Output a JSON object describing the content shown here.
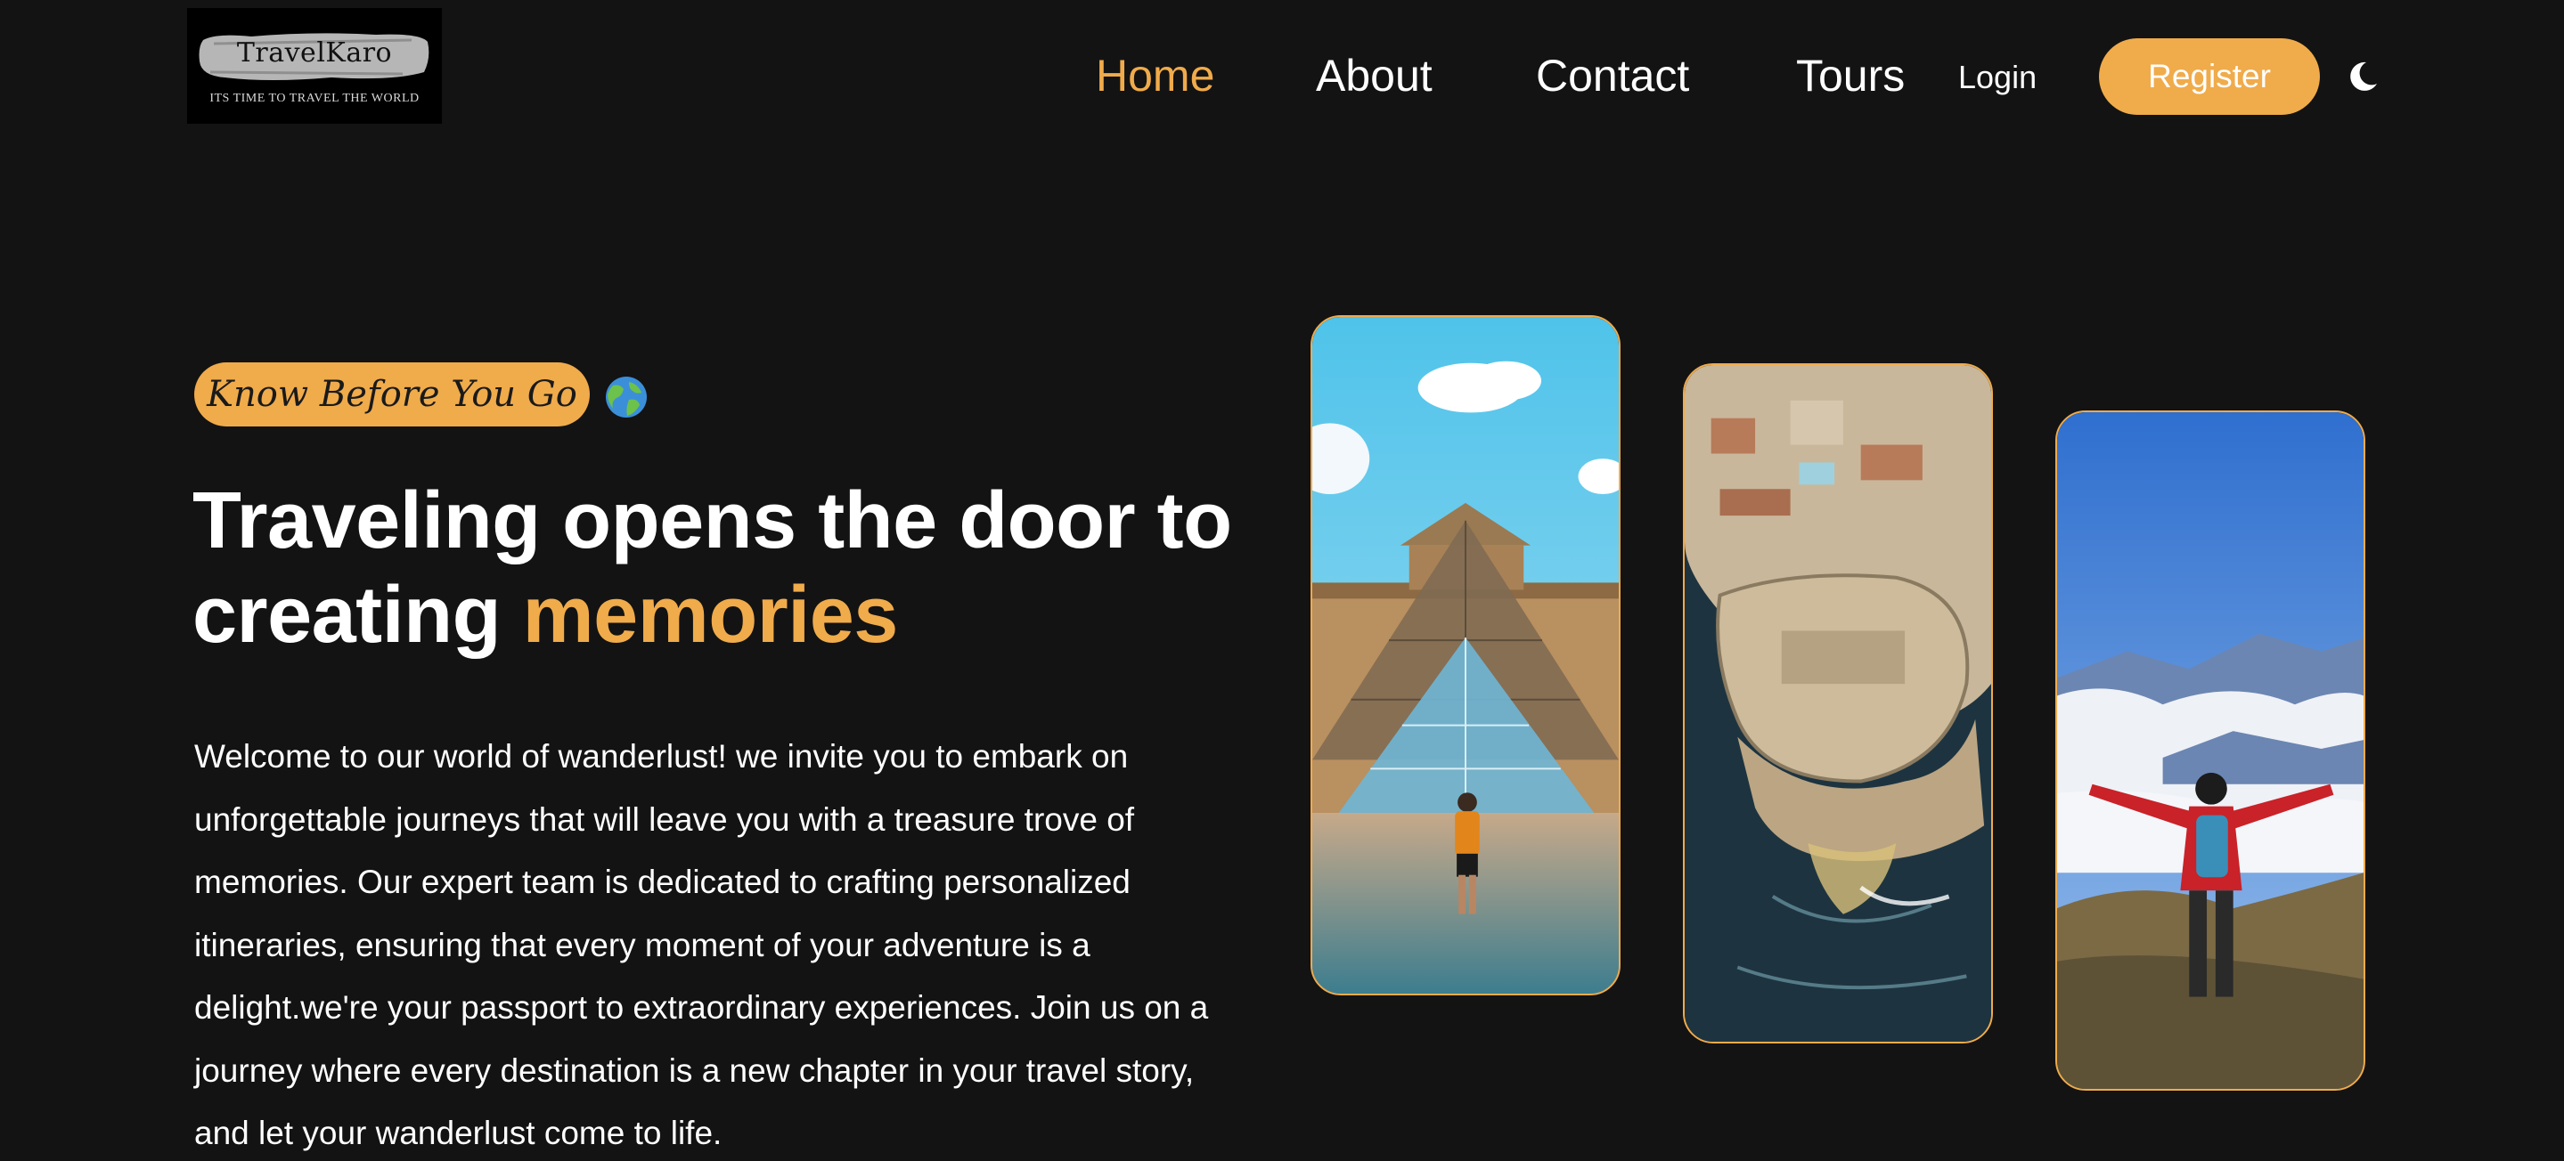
{
  "header": {
    "logo": {
      "name": "TravelKaro",
      "tagline": "Its time to travel the world"
    },
    "nav": [
      {
        "label": "Home",
        "active": true
      },
      {
        "label": "About",
        "active": false
      },
      {
        "label": "Contact",
        "active": false
      },
      {
        "label": "Tours",
        "active": false
      }
    ],
    "login_label": "Login",
    "register_label": "Register",
    "theme_icon": "moon-icon"
  },
  "hero": {
    "badge": "Know Before You Go",
    "badge_icon": "globe-icon",
    "headline_part1": "Traveling opens the door to creating ",
    "headline_accent": "memories",
    "description": "Welcome to our world of wanderlust! we invite you to embark on unforgettable journeys that will leave you with a treasure trove of memories. Our expert team is dedicated to crafting personalized itineraries, ensuring that every moment of your adventure is a delight.we're your passport to extraordinary experiences. Join us on a journey where every destination is a new chapter in your travel story, and let your wanderlust come to life."
  },
  "gallery": [
    {
      "name": "louvre-photo"
    },
    {
      "name": "fortress-photo"
    },
    {
      "name": "hiker-photo"
    }
  ],
  "colors": {
    "background": "#131313",
    "accent": "#f0ab4b",
    "text": "#ffffff"
  }
}
